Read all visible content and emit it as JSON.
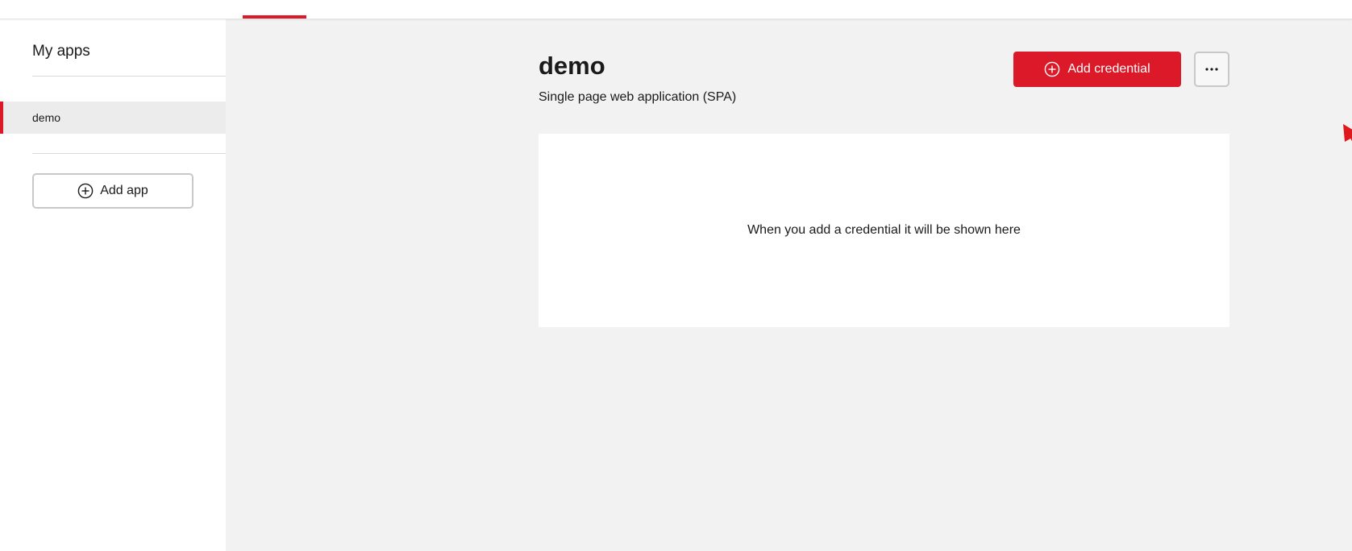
{
  "sidebar": {
    "title": "My apps",
    "items": [
      {
        "label": "demo",
        "selected": true
      }
    ],
    "add_app_label": "Add app"
  },
  "main": {
    "app_name": "demo",
    "app_type": "Single page web application (SPA)",
    "add_credential_label": "Add credential",
    "more_label": "···",
    "empty_message": "When you add a credential it will be shown here"
  },
  "icons": {
    "add_app": "plus-circle-icon",
    "add_credential": "plus-circle-icon",
    "more": "more-horizontal-icon"
  },
  "colors": {
    "accent": "#dc1928",
    "background": "#f2f2f2",
    "surface": "#ffffff"
  }
}
